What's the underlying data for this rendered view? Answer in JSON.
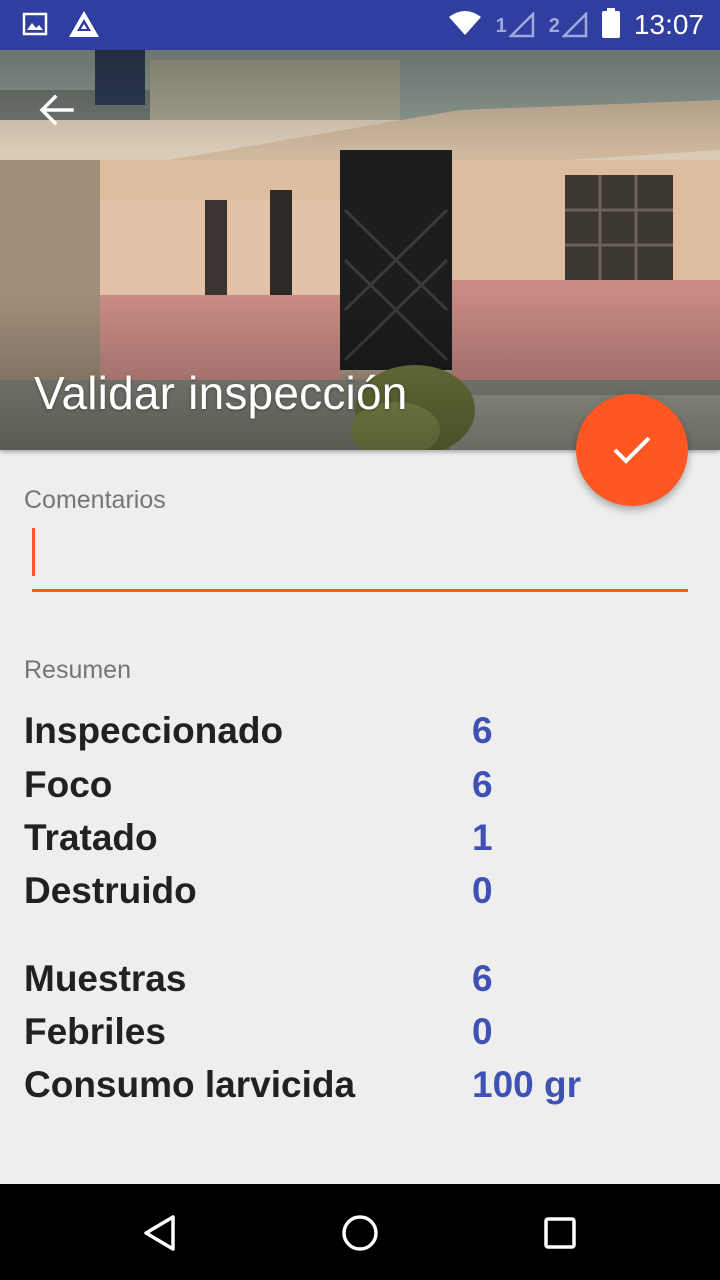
{
  "status_bar": {
    "time": "13:07",
    "sim1": "1",
    "sim2": "2",
    "icons": [
      "image-icon",
      "app-logo-icon",
      "wifi-icon",
      "signal-icon",
      "battery-icon"
    ]
  },
  "header": {
    "title": "Validar inspección",
    "back_icon": "arrow-back-icon"
  },
  "fab": {
    "icon": "check-icon",
    "color": "#ff5722"
  },
  "comments": {
    "label": "Comentarios",
    "value": ""
  },
  "summary": {
    "label": "Resumen",
    "group1": [
      {
        "label": "Inspeccionado",
        "value": "6"
      },
      {
        "label": "Foco",
        "value": "6"
      },
      {
        "label": "Tratado",
        "value": "1"
      },
      {
        "label": "Destruido",
        "value": "0"
      }
    ],
    "group2": [
      {
        "label": "Muestras",
        "value": "6"
      },
      {
        "label": "Febriles",
        "value": "0"
      },
      {
        "label": "Consumo larvicida",
        "value": "100 gr"
      }
    ]
  },
  "nav_bar": {
    "icons": [
      "back-triangle-icon",
      "home-circle-icon",
      "recents-square-icon"
    ]
  },
  "colors": {
    "primary_dark": "#303f9f",
    "accent": "#ff5722",
    "value_text": "#3f51b5"
  }
}
